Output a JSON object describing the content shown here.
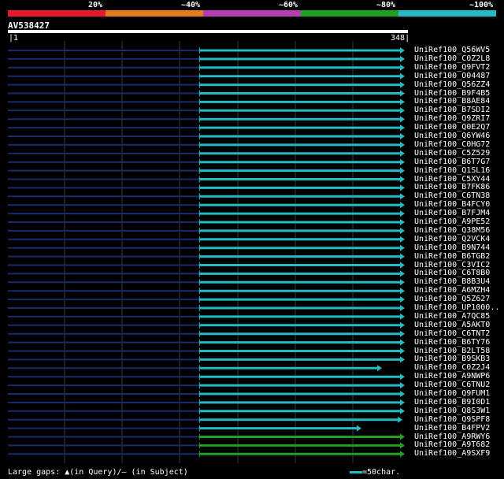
{
  "scale": {
    "labels": [
      "20%",
      "~40%",
      "~60%",
      "~80%",
      "~100%"
    ],
    "colors": [
      "#e8192f",
      "#e87a1e",
      "#b43fb4",
      "#20a020",
      "#23bcc4"
    ]
  },
  "query": {
    "id": "AV538427",
    "start": "1",
    "end": "348"
  },
  "footer": {
    "text": "Large gaps: ▲(in Query)/– (in Subject)"
  },
  "legend": {
    "text": "=50char."
  },
  "hits": [
    {
      "name": "UniRef100_Q56WV5",
      "qs": 1,
      "ms": 168,
      "me": 348,
      "color": "cyan"
    },
    {
      "name": "UniRef100_C0Z2L8",
      "qs": 1,
      "ms": 168,
      "me": 348,
      "color": "cyan"
    },
    {
      "name": "UniRef100_Q9FVT2",
      "qs": 1,
      "ms": 168,
      "me": 348,
      "color": "cyan"
    },
    {
      "name": "UniRef100_O04487",
      "qs": 1,
      "ms": 168,
      "me": 348,
      "color": "cyan"
    },
    {
      "name": "UniRef100_Q56ZZ4",
      "qs": 1,
      "ms": 168,
      "me": 348,
      "color": "cyan"
    },
    {
      "name": "UniRef100_B9F4B5",
      "qs": 1,
      "ms": 168,
      "me": 348,
      "color": "cyan"
    },
    {
      "name": "UniRef100_B8AE84",
      "qs": 1,
      "ms": 168,
      "me": 348,
      "color": "cyan"
    },
    {
      "name": "UniRef100_B7SDI2",
      "qs": 1,
      "ms": 168,
      "me": 348,
      "color": "cyan"
    },
    {
      "name": "UniRef100_Q9ZRI7",
      "qs": 1,
      "ms": 168,
      "me": 348,
      "color": "cyan"
    },
    {
      "name": "UniRef100_Q0E2Q7",
      "qs": 1,
      "ms": 168,
      "me": 348,
      "color": "cyan"
    },
    {
      "name": "UniRef100_Q6YW46",
      "qs": 1,
      "ms": 168,
      "me": 348,
      "color": "cyan"
    },
    {
      "name": "UniRef100_C0HG72",
      "qs": 1,
      "ms": 168,
      "me": 348,
      "color": "cyan"
    },
    {
      "name": "UniRef100_C5Z529",
      "qs": 1,
      "ms": 168,
      "me": 348,
      "color": "cyan"
    },
    {
      "name": "UniRef100_B6T7G7",
      "qs": 1,
      "ms": 168,
      "me": 348,
      "color": "cyan"
    },
    {
      "name": "UniRef100_Q1SL16",
      "qs": 1,
      "ms": 168,
      "me": 348,
      "color": "cyan"
    },
    {
      "name": "UniRef100_C5XY44",
      "qs": 1,
      "ms": 168,
      "me": 348,
      "color": "cyan"
    },
    {
      "name": "UniRef100_B7FK86",
      "qs": 1,
      "ms": 168,
      "me": 348,
      "color": "cyan"
    },
    {
      "name": "UniRef100_C6TN38",
      "qs": 1,
      "ms": 168,
      "me": 348,
      "color": "cyan"
    },
    {
      "name": "UniRef100_B4FCY0",
      "qs": 1,
      "ms": 168,
      "me": 348,
      "color": "cyan"
    },
    {
      "name": "UniRef100_B7FJM4",
      "qs": 1,
      "ms": 168,
      "me": 348,
      "color": "cyan"
    },
    {
      "name": "UniRef100_A9PE52",
      "qs": 1,
      "ms": 168,
      "me": 348,
      "color": "cyan"
    },
    {
      "name": "UniRef100_Q38M56",
      "qs": 1,
      "ms": 168,
      "me": 348,
      "color": "cyan"
    },
    {
      "name": "UniRef100_Q2VCK4",
      "qs": 1,
      "ms": 168,
      "me": 348,
      "color": "cyan"
    },
    {
      "name": "UniRef100_B9N744",
      "qs": 1,
      "ms": 168,
      "me": 348,
      "color": "cyan"
    },
    {
      "name": "UniRef100_B6TGB2",
      "qs": 1,
      "ms": 168,
      "me": 348,
      "color": "cyan"
    },
    {
      "name": "UniRef100_C3VIC2",
      "qs": 1,
      "ms": 168,
      "me": 348,
      "color": "cyan"
    },
    {
      "name": "UniRef100_C6T8B0",
      "qs": 1,
      "ms": 168,
      "me": 348,
      "color": "cyan"
    },
    {
      "name": "UniRef100_B8B3U4",
      "qs": 1,
      "ms": 168,
      "me": 348,
      "color": "cyan"
    },
    {
      "name": "UniRef100_A6MZH4",
      "qs": 1,
      "ms": 168,
      "me": 348,
      "color": "cyan"
    },
    {
      "name": "UniRef100_Q5Z627",
      "qs": 1,
      "ms": 168,
      "me": 348,
      "color": "cyan"
    },
    {
      "name": "UniRef100_UP1000..",
      "qs": 1,
      "ms": 168,
      "me": 348,
      "color": "cyan"
    },
    {
      "name": "UniRef100_A7QC85",
      "qs": 1,
      "ms": 168,
      "me": 348,
      "color": "cyan"
    },
    {
      "name": "UniRef100_A5AKT0",
      "qs": 1,
      "ms": 168,
      "me": 348,
      "color": "cyan"
    },
    {
      "name": "UniRef100_C6TNT2",
      "qs": 1,
      "ms": 168,
      "me": 348,
      "color": "cyan"
    },
    {
      "name": "UniRef100_B6TY76",
      "qs": 1,
      "ms": 168,
      "me": 348,
      "color": "cyan"
    },
    {
      "name": "UniRef100_B2LT58",
      "qs": 1,
      "ms": 168,
      "me": 348,
      "color": "cyan"
    },
    {
      "name": "UniRef100_B9SKB3",
      "qs": 1,
      "ms": 168,
      "me": 348,
      "color": "cyan"
    },
    {
      "name": "UniRef100_C0Z2J4",
      "qs": 1,
      "ms": 168,
      "me": 328,
      "color": "cyan"
    },
    {
      "name": "UniRef100_A9NWP6",
      "qs": 1,
      "ms": 168,
      "me": 348,
      "color": "cyan"
    },
    {
      "name": "UniRef100_C6TNU2",
      "qs": 1,
      "ms": 168,
      "me": 348,
      "color": "cyan"
    },
    {
      "name": "UniRef100_Q9FUM1",
      "qs": 1,
      "ms": 168,
      "me": 348,
      "color": "cyan"
    },
    {
      "name": "UniRef100_B9I0D1",
      "qs": 1,
      "ms": 168,
      "me": 348,
      "color": "cyan"
    },
    {
      "name": "UniRef100_Q8S3W1",
      "qs": 1,
      "ms": 168,
      "me": 348,
      "color": "cyan"
    },
    {
      "name": "UniRef100_Q9SPF8",
      "qs": 1,
      "ms": 168,
      "me": 346,
      "color": "cyan"
    },
    {
      "name": "UniRef100_B4FPV2",
      "qs": 1,
      "ms": 168,
      "me": 310,
      "color": "cyan"
    },
    {
      "name": "UniRef100_A9RWY6",
      "qs": 1,
      "ms": 168,
      "me": 348,
      "color": "green"
    },
    {
      "name": "UniRef100_A9T682",
      "qs": 1,
      "ms": 168,
      "me": 348,
      "color": "green"
    },
    {
      "name": "UniRef100_A9SXF9",
      "qs": 1,
      "ms": 168,
      "me": 348,
      "color": "green"
    }
  ],
  "colors": {
    "cyan": "#23bcc4",
    "green": "#20a020",
    "faint": "#1a2a6a",
    "grid": "#3a3a3a"
  }
}
